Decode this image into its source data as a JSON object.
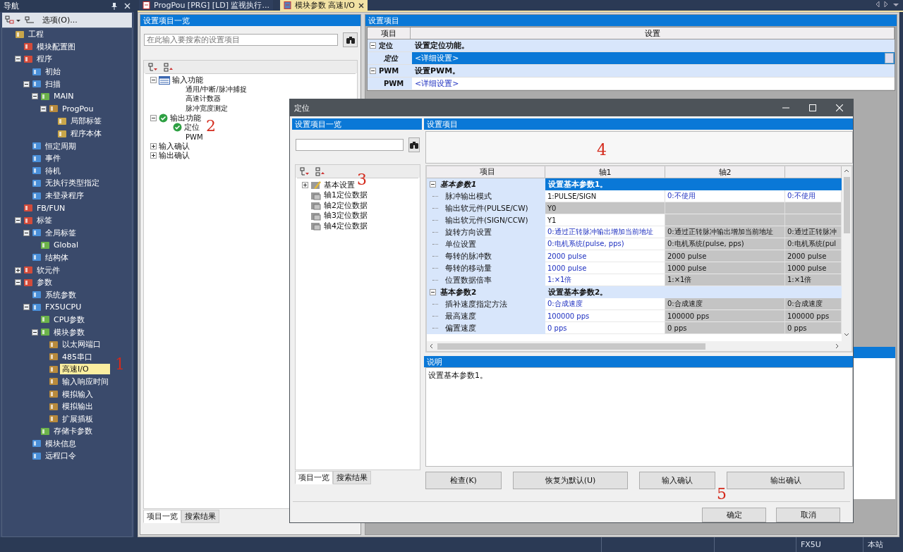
{
  "nav": {
    "title": "导航",
    "toolbar_label": "选项(O)...",
    "tree": [
      {
        "label": "工程",
        "selected": false,
        "children": [
          {
            "label": "模块配置图",
            "selected": false
          },
          {
            "label": "程序",
            "selected": false,
            "expanded": true,
            "children": [
              {
                "label": "初始",
                "selected": false
              },
              {
                "label": "扫描",
                "selected": false,
                "expanded": true,
                "children": [
                  {
                    "label": "MAIN",
                    "selected": false,
                    "expanded": true,
                    "children": [
                      {
                        "label": "ProgPou",
                        "selected": false,
                        "expanded": true,
                        "children": [
                          {
                            "label": "局部标签",
                            "selected": false
                          },
                          {
                            "label": "程序本体",
                            "selected": false
                          }
                        ]
                      }
                    ]
                  }
                ]
              },
              {
                "label": "恒定周期",
                "selected": false
              },
              {
                "label": "事件",
                "selected": false
              },
              {
                "label": "待机",
                "selected": false
              },
              {
                "label": "无执行类型指定",
                "selected": false
              },
              {
                "label": "未登录程序",
                "selected": false
              }
            ]
          },
          {
            "label": "FB/FUN",
            "selected": false
          },
          {
            "label": "标签",
            "selected": false,
            "expanded": true,
            "children": [
              {
                "label": "全局标签",
                "selected": false,
                "expanded": true,
                "children": [
                  {
                    "label": "Global",
                    "selected": false
                  }
                ]
              },
              {
                "label": "结构体",
                "selected": false
              }
            ]
          },
          {
            "label": "软元件",
            "selected": false,
            "expanded": false
          },
          {
            "label": "参数",
            "selected": false,
            "expanded": true,
            "children": [
              {
                "label": "系统参数",
                "selected": false
              },
              {
                "label": "FX5UCPU",
                "selected": false,
                "expanded": true,
                "children": [
                  {
                    "label": "CPU参数",
                    "selected": false
                  },
                  {
                    "label": "模块参数",
                    "selected": false,
                    "expanded": true,
                    "children": [
                      {
                        "label": "以太网端口",
                        "selected": false
                      },
                      {
                        "label": "485串口",
                        "selected": false
                      },
                      {
                        "label": "高速I/O",
                        "selected": true
                      },
                      {
                        "label": "输入响应时间",
                        "selected": false
                      },
                      {
                        "label": "模拟输入",
                        "selected": false
                      },
                      {
                        "label": "模拟输出",
                        "selected": false
                      },
                      {
                        "label": "扩展插板",
                        "selected": false
                      }
                    ]
                  },
                  {
                    "label": "存储卡参数",
                    "selected": false
                  }
                ]
              },
              {
                "label": "模块信息",
                "selected": false
              },
              {
                "label": "远程口令",
                "selected": false
              }
            ]
          }
        ]
      }
    ]
  },
  "tabs": [
    {
      "label": "ProgPou [PRG] [LD] 监视执行...",
      "selected": false
    },
    {
      "label": "模块参数 高速I/O",
      "selected": true
    }
  ],
  "settings_list": {
    "title": "设置项目一览",
    "search": {
      "placeholder": "在此输入要搜索的设置项目"
    },
    "tree": [
      {
        "label": "输入功能",
        "checked": false,
        "expanded": true,
        "children": [
          {
            "label": "通用/中断/脉冲捕捉",
            "checked": false
          },
          {
            "label": "高速计数器",
            "checked": false
          },
          {
            "label": "脉冲宽度测定",
            "checked": false
          }
        ]
      },
      {
        "label": "输出功能",
        "checked": true,
        "expanded": true,
        "children": [
          {
            "label": "定位",
            "checked": true
          },
          {
            "label": "PWM",
            "checked": false
          }
        ]
      },
      {
        "label": "输入确认",
        "checked": false,
        "expanded": false
      },
      {
        "label": "输出确认",
        "checked": false,
        "expanded": false
      }
    ],
    "bottom_tabs": [
      {
        "label": "项目一览",
        "selected": true
      },
      {
        "label": "搜索结果",
        "selected": false
      }
    ]
  },
  "settings": {
    "title": "设置项目",
    "columns": [
      "项目",
      "设置"
    ],
    "rows": [
      {
        "kind": "section",
        "item": "定位",
        "value": "设置定位功能。"
      },
      {
        "kind": "entry",
        "item": "定位",
        "value": "<详细设置>",
        "selected": true
      },
      {
        "kind": "section",
        "item": "PWM",
        "value": "设置PWM。"
      },
      {
        "kind": "entry",
        "item": "PWM",
        "value": "<详细设置>",
        "selected": false
      }
    ]
  },
  "dialog": {
    "title": "定位",
    "list": {
      "title": "设置项目一览",
      "tree": [
        {
          "label": "基本设置",
          "kind": "edit",
          "expanded": false
        },
        {
          "label": "轴1定位数据",
          "kind": "data"
        },
        {
          "label": "轴2定位数据",
          "kind": "data"
        },
        {
          "label": "轴3定位数据",
          "kind": "data"
        },
        {
          "label": "轴4定位数据",
          "kind": "data"
        }
      ],
      "bottom_tabs": [
        {
          "label": "项目一览",
          "selected": true
        },
        {
          "label": "搜索结果",
          "selected": false
        }
      ]
    },
    "settings": {
      "title": "设置项目",
      "columns": [
        "项目",
        "轴1",
        "轴2"
      ],
      "rows": [
        {
          "kind": "section",
          "item": "基本参数1",
          "description": "设置基本参数1。",
          "selected": true
        },
        {
          "kind": "entry",
          "item": "脉冲输出模式",
          "cells": [
            {
              "text": "1:PULSE/SIGN",
              "blue": false,
              "gray": false
            },
            {
              "text": "0:不使用",
              "blue": true,
              "gray": false
            },
            {
              "text": "0:不使用",
              "blue": true,
              "gray": false
            }
          ]
        },
        {
          "kind": "entry",
          "item": "输出软元件(PULSE/CW)",
          "cells": [
            {
              "text": "Y0",
              "blue": false,
              "gray": true
            },
            {
              "blue": false,
              "gray": true
            },
            {
              "blue": false,
              "gray": true
            }
          ]
        },
        {
          "kind": "entry",
          "item": "输出软元件(SIGN/CCW)",
          "cells": [
            {
              "text": "Y1",
              "blue": false,
              "gray": false
            },
            {
              "blue": false,
              "gray": true
            },
            {
              "blue": false,
              "gray": true
            }
          ]
        },
        {
          "kind": "entry",
          "item": "旋转方向设置",
          "cells": [
            {
              "text": "0:通过正转脉冲输出增加当前地址",
              "blue": true,
              "gray": false
            },
            {
              "text": "0:通过正转脉冲输出增加当前地址",
              "blue": false,
              "gray": true
            },
            {
              "text": "0:通过正转脉冲",
              "blue": false,
              "gray": true
            }
          ]
        },
        {
          "kind": "entry",
          "item": "单位设置",
          "cells": [
            {
              "text": "0:电机系统(pulse, pps)",
              "blue": true,
              "gray": false
            },
            {
              "text": "0:电机系统(pulse, pps)",
              "blue": false,
              "gray": true
            },
            {
              "text": "0:电机系统(pul",
              "blue": false,
              "gray": true
            }
          ]
        },
        {
          "kind": "entry",
          "item": "每转的脉冲数",
          "cells": [
            {
              "text": "2000 pulse",
              "blue": true,
              "gray": false
            },
            {
              "text": "2000 pulse",
              "blue": false,
              "gray": true
            },
            {
              "text": "2000 pulse",
              "blue": false,
              "gray": true
            }
          ]
        },
        {
          "kind": "entry",
          "item": "每转的移动量",
          "cells": [
            {
              "text": "1000 pulse",
              "blue": true,
              "gray": false
            },
            {
              "text": "1000 pulse",
              "blue": false,
              "gray": true
            },
            {
              "text": "1000 pulse",
              "blue": false,
              "gray": true
            }
          ]
        },
        {
          "kind": "entry",
          "item": "位置数据倍率",
          "cells": [
            {
              "text": "1:×1倍",
              "blue": true,
              "gray": false
            },
            {
              "text": "1:×1倍",
              "blue": false,
              "gray": true
            },
            {
              "text": "1:×1倍",
              "blue": false,
              "gray": true
            }
          ]
        },
        {
          "kind": "section",
          "item": "基本参数2",
          "description": "设置基本参数2。",
          "selected": false
        },
        {
          "kind": "entry",
          "item": "插补速度指定方法",
          "cells": [
            {
              "text": "0:合成速度",
              "blue": true,
              "gray": false
            },
            {
              "text": "0:合成速度",
              "blue": false,
              "gray": true
            },
            {
              "text": "0:合成速度",
              "blue": false,
              "gray": true
            }
          ]
        },
        {
          "kind": "entry",
          "item": "最高速度",
          "cells": [
            {
              "text": "100000 pps",
              "blue": true,
              "gray": false
            },
            {
              "text": "100000 pps",
              "blue": false,
              "gray": true
            },
            {
              "text": "100000 pps",
              "blue": false,
              "gray": true
            }
          ]
        },
        {
          "kind": "entry",
          "item": "偏置速度",
          "cells": [
            {
              "text": "0 pps",
              "blue": true,
              "gray": false
            },
            {
              "text": "0 pps",
              "blue": false,
              "gray": true
            },
            {
              "text": "0 pps",
              "blue": false,
              "gray": true
            }
          ]
        }
      ]
    },
    "description": {
      "title": "说明",
      "text": "设置基本参数1。"
    },
    "action_buttons": [
      "检查(K)",
      "恢复为默认(U)",
      "输入确认",
      "输出确认"
    ],
    "ok": "确定",
    "cancel": "取消"
  },
  "annotations": [
    "1",
    "2",
    "3",
    "4",
    "5"
  ],
  "status_bar": [
    "FX5U",
    "本站"
  ]
}
